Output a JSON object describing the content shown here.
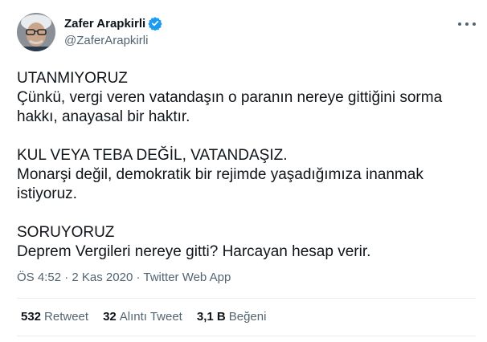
{
  "author": {
    "display_name": "Zafer Arapkirli",
    "handle": "@ZaferArapkirli",
    "verified_color": "#1d9bf0"
  },
  "tweet": {
    "paragraphs": [
      {
        "lines": [
          "UTANMIYORUZ",
          "Çünkü, vergi veren vatandaşın o paranın nereye gittiğini sorma",
          "hakkı, anayasal bir haktır."
        ]
      },
      {
        "lines": [
          "KUL VEYA TEBA DEĞİL, VATANDAŞIZ.",
          "Monarşi değil, demokratik bir rejimde yaşadığımıza inanmak",
          "istiyoruz."
        ]
      },
      {
        "lines": [
          "SORUYORUZ",
          "Deprem Vergileri nereye gitti? Harcayan hesap verir."
        ]
      }
    ]
  },
  "meta": {
    "time": "ÖS 4:52",
    "separator": " · ",
    "date": "2 Kas 2020",
    "source": "Twitter Web App"
  },
  "stats": {
    "retweets": {
      "count": "532",
      "label": "Retweet"
    },
    "quotes": {
      "count": "32",
      "label": "Alıntı Tweet"
    },
    "likes": {
      "count": "3,1 B",
      "label": "Beğeni"
    }
  },
  "icons": {
    "more": "more-horizontal-icon",
    "verified": "verified-badge-icon"
  }
}
